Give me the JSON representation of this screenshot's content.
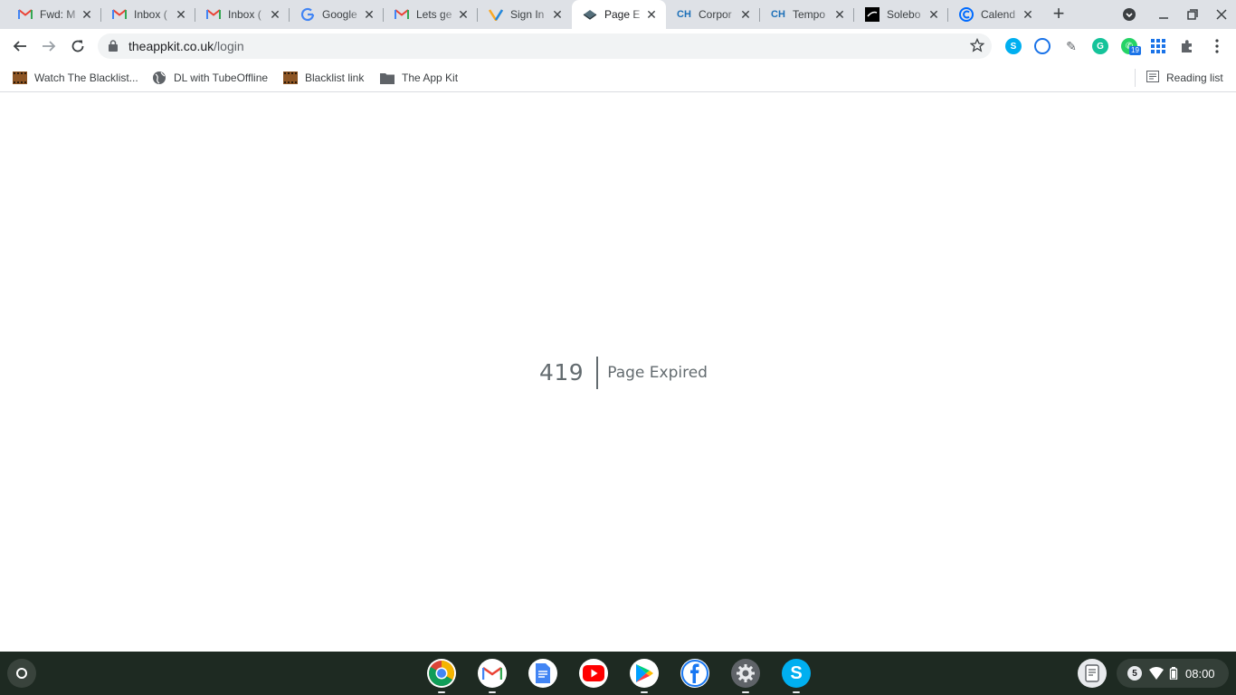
{
  "tabs": [
    {
      "title": "Fwd: M",
      "icon": "gmail-icon"
    },
    {
      "title": "Inbox (",
      "icon": "gmail-icon"
    },
    {
      "title": "Inbox (",
      "icon": "gmail-icon"
    },
    {
      "title": "Google",
      "icon": "google-icon"
    },
    {
      "title": "Lets ge",
      "icon": "gmail-icon"
    },
    {
      "title": "Sign In",
      "icon": "v-logo-icon"
    },
    {
      "title": "Page E",
      "icon": "laravel-icon",
      "active": true
    },
    {
      "title": "Corpor",
      "icon": "ch-icon",
      "icon_text": "CH"
    },
    {
      "title": "Tempo",
      "icon": "ch-icon",
      "icon_text": "CH"
    },
    {
      "title": "Solebo",
      "icon": "solebox-icon"
    },
    {
      "title": "Calend",
      "icon": "calendly-icon"
    }
  ],
  "toolbar": {
    "url_host": "theappkit.co.uk",
    "url_path": "/login",
    "extension_badge": "19"
  },
  "bookmarks": [
    {
      "label": "Watch The Blacklist...",
      "icon": "film-icon"
    },
    {
      "label": "DL with TubeOffline",
      "icon": "globe-icon"
    },
    {
      "label": "Blacklist link",
      "icon": "film-icon"
    },
    {
      "label": "The App Kit",
      "icon": "folder-icon"
    }
  ],
  "reading_list": "Reading list",
  "error": {
    "code": "419",
    "message": "Page Expired"
  },
  "shelf": {
    "apps": [
      "chrome-icon",
      "gmail-icon",
      "docs-icon",
      "youtube-icon",
      "play-store-icon",
      "facebook-icon",
      "settings-icon",
      "skype-icon"
    ],
    "notification_count": "5",
    "time": "08:00"
  },
  "colors": {
    "tabstrip": "#dee1e6",
    "error_text": "#636b6f",
    "shelf": "#1e2a22"
  }
}
